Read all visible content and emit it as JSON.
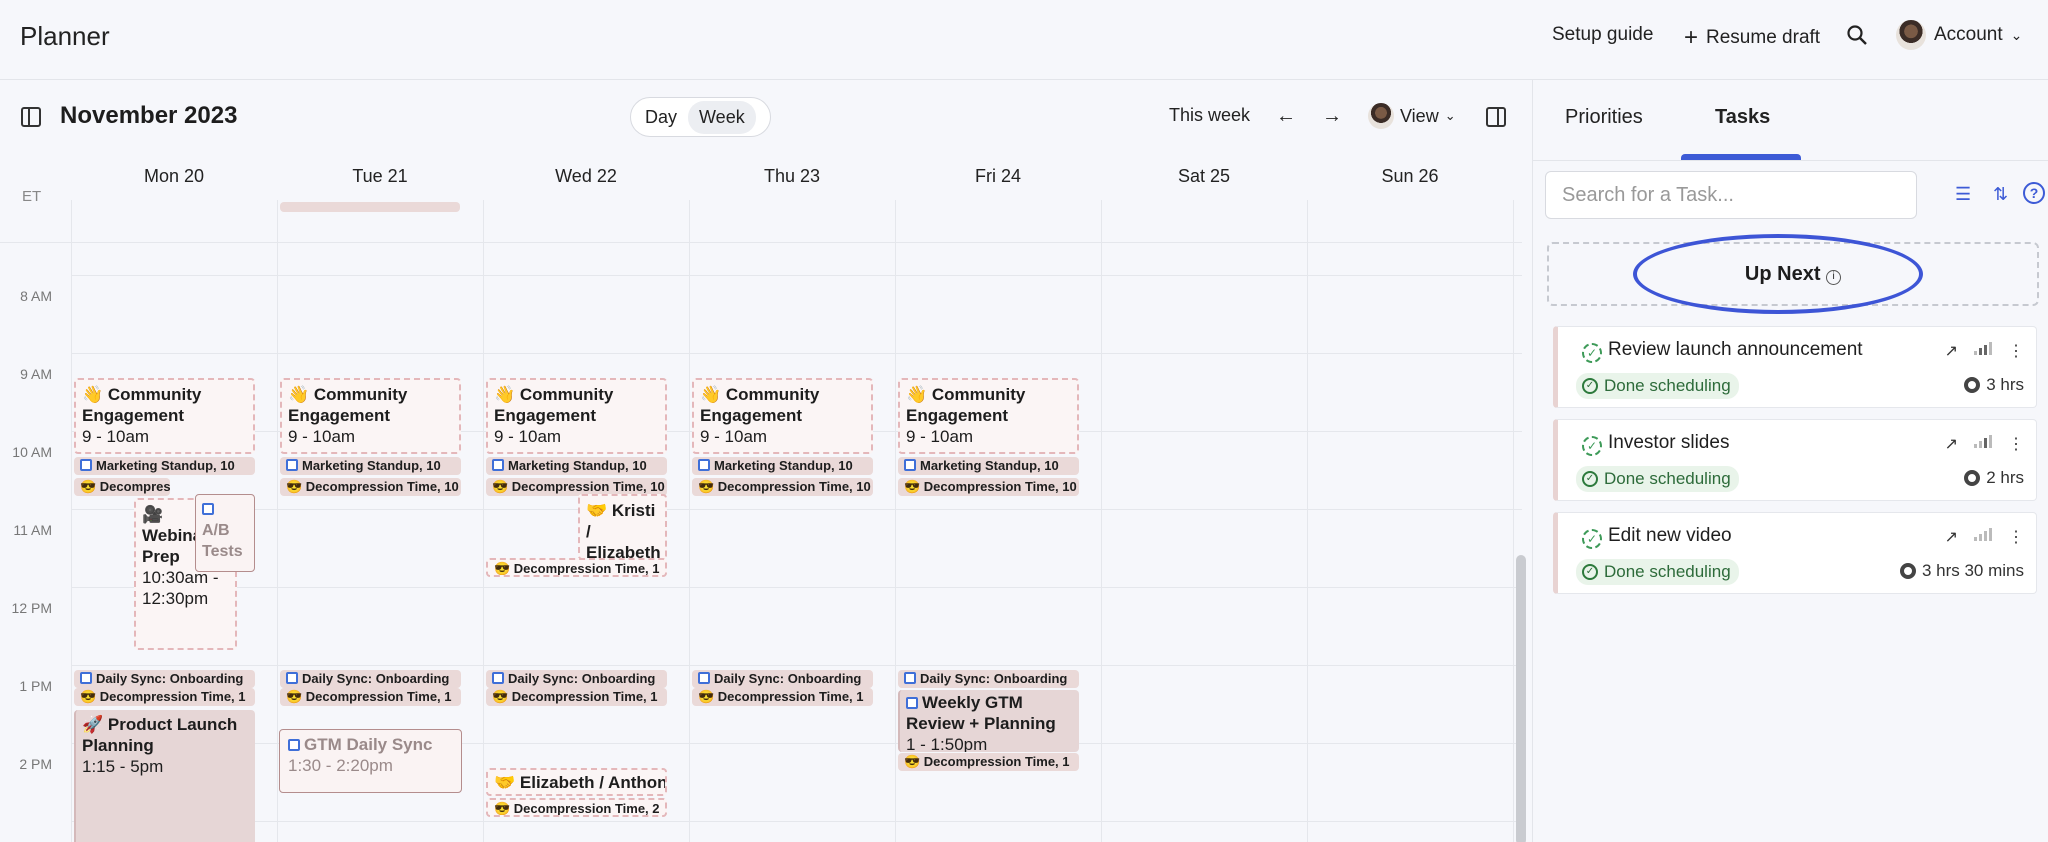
{
  "app": {
    "title": "Planner"
  },
  "topbar": {
    "setup_guide": "Setup guide",
    "resume_draft": "Resume draft",
    "account": "Account"
  },
  "calendar": {
    "month": "November 2023",
    "view_toggle": {
      "day": "Day",
      "week": "Week",
      "active": "Week"
    },
    "this_week": "This week",
    "view": "View",
    "timezone": "ET",
    "days": [
      "Mon 20",
      "Tue 21",
      "Wed 22",
      "Thu 23",
      "Fri 24",
      "Sat 25",
      "Sun 26"
    ],
    "hours": [
      "8 AM",
      "9 AM",
      "10 AM",
      "11 AM",
      "12 PM",
      "1 PM",
      "2 PM"
    ],
    "events": {
      "community_title": "👋 Community Engagement",
      "community_time": "9 - 10am",
      "marketing": "Marketing Standup, 10",
      "decompression": "😎 Decompression Time, 10",
      "webinar_title": "🎥 Webinar Prep",
      "webinar_time": "10:30am - 12:30pm",
      "ab_tests": "A/B Tests",
      "kristi": "🤝 Kristi / Elizabeth",
      "daily_sync": "Daily Sync: Onboarding",
      "decompression_1": "😎 Decompression Time, 1",
      "launch_title": "🚀 Product Launch Planning",
      "launch_time": "1:15 - 5pm",
      "gtm_title": "GTM Daily Sync",
      "gtm_time": "1:30 - 2:20pm",
      "weekly_title": "Weekly GTM Review + Planning",
      "weekly_time": "1 - 1:50pm",
      "elizabeth": "🤝 Elizabeth / Anthony",
      "decompression_2": "😎 Decompression Time, 2"
    }
  },
  "panel": {
    "tabs": [
      "Priorities",
      "Tasks"
    ],
    "active_tab": "Tasks",
    "search_placeholder": "Search for a Task...",
    "up_next": "Up Next",
    "tasks": [
      {
        "name": "Review launch announcement",
        "status": "Done scheduling",
        "duration": "3 hrs"
      },
      {
        "name": "Investor slides",
        "status": "Done scheduling",
        "duration": "2 hrs"
      },
      {
        "name": "Edit new video",
        "status": "Done scheduling",
        "duration": "3 hrs 30 mins"
      }
    ]
  },
  "colors": {
    "accent": "#3d5bd6",
    "event_bg": "#e6d6d6",
    "success": "#2d6b3a"
  }
}
